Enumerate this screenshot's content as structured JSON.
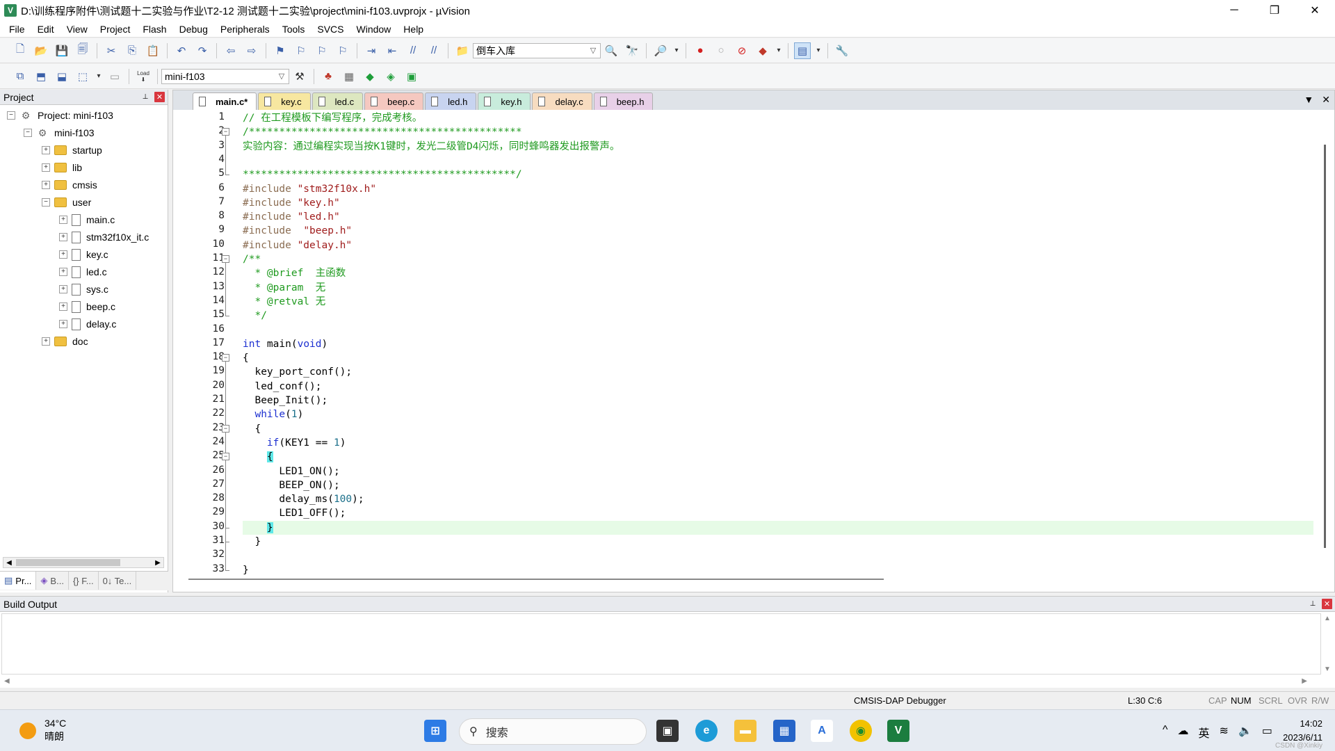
{
  "window": {
    "title": "D:\\训练程序附件\\测试题十二实验与作业\\T2-12  测试题十二实验\\project\\mini-f103.uvprojx - µVision",
    "app_icon": "V",
    "minimize": "─",
    "maximize": "❐",
    "close": "✕"
  },
  "menu": [
    "File",
    "Edit",
    "View",
    "Project",
    "Flash",
    "Debug",
    "Peripherals",
    "Tools",
    "SVCS",
    "Window",
    "Help"
  ],
  "toolbar1": {
    "find_combo_value": "倒车入库"
  },
  "toolbar2": {
    "target_combo_value": "mini-f103",
    "load_label": "Load"
  },
  "project_panel": {
    "title": "Project",
    "pin": "📌",
    "close": "✕",
    "tree": {
      "project": "Project: mini-f103",
      "target": "mini-f103",
      "groups": [
        "startup",
        "lib",
        "cmsis",
        "user"
      ],
      "user_files": [
        "main.c",
        "stm32f10x_it.c",
        "key.c",
        "led.c",
        "sys.c",
        "beep.c",
        "delay.c"
      ],
      "last_group": "doc"
    },
    "tabs": [
      {
        "label": "Pr...",
        "icon": "project-icon"
      },
      {
        "label": "B...",
        "icon": "books-icon"
      },
      {
        "label": "{} F...",
        "icon": "functions-icon"
      },
      {
        "label": "0↓ Te...",
        "icon": "templates-icon"
      }
    ]
  },
  "editor": {
    "tabs": [
      {
        "label": "main.c*",
        "color": "#ffffff",
        "active": true
      },
      {
        "label": "key.c",
        "color": "#f7e7a0",
        "active": false
      },
      {
        "label": "led.c",
        "color": "#dde7c0",
        "active": false
      },
      {
        "label": "beep.c",
        "color": "#f5c8c0",
        "active": false
      },
      {
        "label": "led.h",
        "color": "#c8d4f0",
        "active": false
      },
      {
        "label": "key.h",
        "color": "#c8ecdc",
        "active": false
      },
      {
        "label": "delay.c",
        "color": "#f7dcc0",
        "active": false
      },
      {
        "label": "beep.h",
        "color": "#e8d0e8",
        "active": false
      }
    ],
    "tab_menu": "▼",
    "tab_close": "✕",
    "current_line": 30,
    "lines": [
      "// 在工程模板下编写程序，完成考核。",
      "/*********************************************",
      "实验内容：通过编程实现当按K1键时，发光二级管D4闪烁，同时蜂鸣器发出报警声。",
      "",
      "*********************************************/",
      "#include \"stm32f10x.h\"",
      "#include \"key.h\"",
      "#include \"led.h\"",
      "#include  \"beep.h\"",
      "#include \"delay.h\"",
      "/**",
      "  * @brief  主函数",
      "  * @param  无",
      "  * @retval 无",
      "  */",
      "",
      "int main(void)",
      "{",
      "  key_port_conf();",
      "  led_conf();",
      "  Beep_Init();",
      "  while(1)",
      "  {",
      "    if(KEY1 == 1)",
      "    {",
      "      LED1_ON();",
      "      BEEP_ON();",
      "      delay_ms(100);",
      "      LED1_OFF();",
      "    }",
      "  }",
      "",
      "}"
    ]
  },
  "build_output": {
    "title": "Build Output",
    "pin": "📌",
    "close": "✕"
  },
  "statusbar": {
    "debugger": "CMSIS-DAP Debugger",
    "position": "L:30 C:6",
    "cap": "CAP",
    "num": "NUM",
    "scrl": "SCRL",
    "ovr": "OVR",
    "rw": "R/W"
  },
  "taskbar": {
    "temperature": "34°C",
    "weather": "晴朗",
    "search_placeholder": "搜索",
    "ime": "英",
    "time": "14:02",
    "date": "2023/6/11",
    "watermark": "CSDN @Xinkiy"
  }
}
